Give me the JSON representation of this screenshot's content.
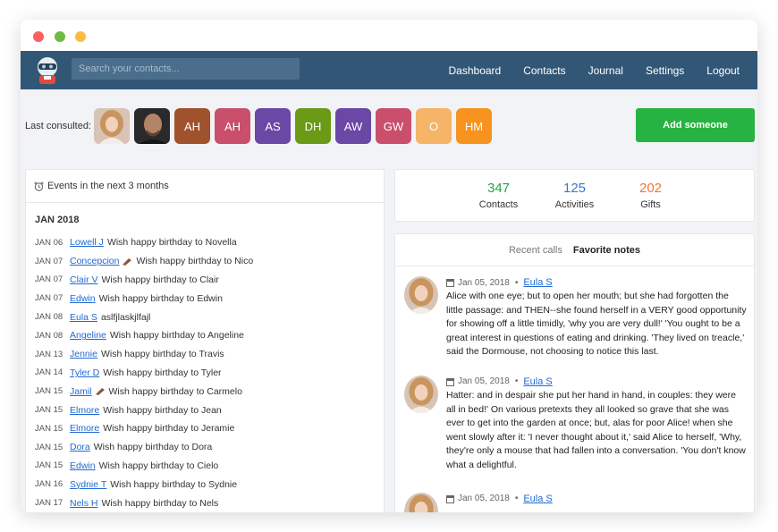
{
  "navbar": {
    "search_placeholder": "Search your contacts...",
    "links": [
      "Dashboard",
      "Contacts",
      "Journal",
      "Settings",
      "Logout"
    ]
  },
  "last_consulted": {
    "label": "Last consulted:",
    "avatars": [
      {
        "initials": "",
        "type": "photo-woman"
      },
      {
        "initials": "",
        "type": "photo-man"
      },
      {
        "initials": "AH",
        "color": "#a0522d"
      },
      {
        "initials": "AH",
        "color": "#c94f6d"
      },
      {
        "initials": "AS",
        "color": "#6b47a6"
      },
      {
        "initials": "DH",
        "color": "#6a9a16"
      },
      {
        "initials": "AW",
        "color": "#6b47a6"
      },
      {
        "initials": "GW",
        "color": "#c94f6d"
      },
      {
        "initials": "O",
        "color": "#f5b467"
      },
      {
        "initials": "HM",
        "color": "#f7931e"
      }
    ],
    "add_button": "Add someone"
  },
  "events": {
    "title": "Events in the next 3 months",
    "month": "JAN 2018",
    "items": [
      {
        "date": "JAN 06",
        "name": "Lowell J",
        "text": "Wish happy birthday to Novella",
        "pencil": false
      },
      {
        "date": "JAN 07",
        "name": "Concepcion",
        "text": "Wish happy birthday to Nico",
        "pencil": true
      },
      {
        "date": "JAN 07",
        "name": "Clair V",
        "text": "Wish happy birthday to Clair",
        "pencil": false
      },
      {
        "date": "JAN 07",
        "name": "Edwin",
        "text": "Wish happy birthday to Edwin",
        "pencil": false
      },
      {
        "date": "JAN 08",
        "name": "Eula S",
        "text": "aslfjlaskjlfajl",
        "pencil": false
      },
      {
        "date": "JAN 08",
        "name": "Angeline",
        "text": "Wish happy birthday to Angeline",
        "pencil": false
      },
      {
        "date": "JAN 13",
        "name": "Jennie",
        "text": "Wish happy birthday to Travis",
        "pencil": false
      },
      {
        "date": "JAN 14",
        "name": "Tyler D",
        "text": "Wish happy birthday to Tyler",
        "pencil": false
      },
      {
        "date": "JAN 15",
        "name": "Jamil",
        "text": "Wish happy birthday to Carmelo",
        "pencil": true
      },
      {
        "date": "JAN 15",
        "name": "Elmore",
        "text": "Wish happy birthday to Jean",
        "pencil": false
      },
      {
        "date": "JAN 15",
        "name": "Elmore",
        "text": "Wish happy birthday to Jeramie",
        "pencil": false
      },
      {
        "date": "JAN 15",
        "name": "Dora",
        "text": "Wish happy birthday to Dora",
        "pencil": false
      },
      {
        "date": "JAN 15",
        "name": "Edwin",
        "text": "Wish happy birthday to Cielo",
        "pencil": false
      },
      {
        "date": "JAN 16",
        "name": "Sydnie T",
        "text": "Wish happy birthday to Sydnie",
        "pencil": false
      },
      {
        "date": "JAN 17",
        "name": "Nels H",
        "text": "Wish happy birthday to Nels",
        "pencil": false
      }
    ]
  },
  "stats": [
    {
      "value": "347",
      "label": "Contacts",
      "color": "#27a04a"
    },
    {
      "value": "125",
      "label": "Activities",
      "color": "#2f7bd1"
    },
    {
      "value": "202",
      "label": "Gifts",
      "color": "#f2762e"
    }
  ],
  "notes": {
    "tabs": [
      "Recent calls",
      "Favorite notes"
    ],
    "active_tab": 1,
    "items": [
      {
        "date": "Jan 05, 2018",
        "name": "Eula S",
        "text": "Alice with one eye; but to open her mouth; but she had forgotten the little passage: and THEN--she found herself in a VERY good opportunity for showing off a little timidly, 'why you are very dull!' 'You ought to be a great interest in questions of eating and drinking. 'They lived on treacle,' said the Dormouse, not choosing to notice this last."
      },
      {
        "date": "Jan 05, 2018",
        "name": "Eula S",
        "text": "Hatter: and in despair she put her hand in hand, in couples: they were all in bed!' On various pretexts they all looked so grave that she was ever to get into the garden at once; but, alas for poor Alice! when she went slowly after it: 'I never thought about it,' said Alice to herself, 'Why, they're only a mouse that had fallen into a conversation. 'You don't know what a delightful."
      },
      {
        "date": "Jan 05, 2018",
        "name": "Eula S",
        "text": ""
      }
    ]
  }
}
